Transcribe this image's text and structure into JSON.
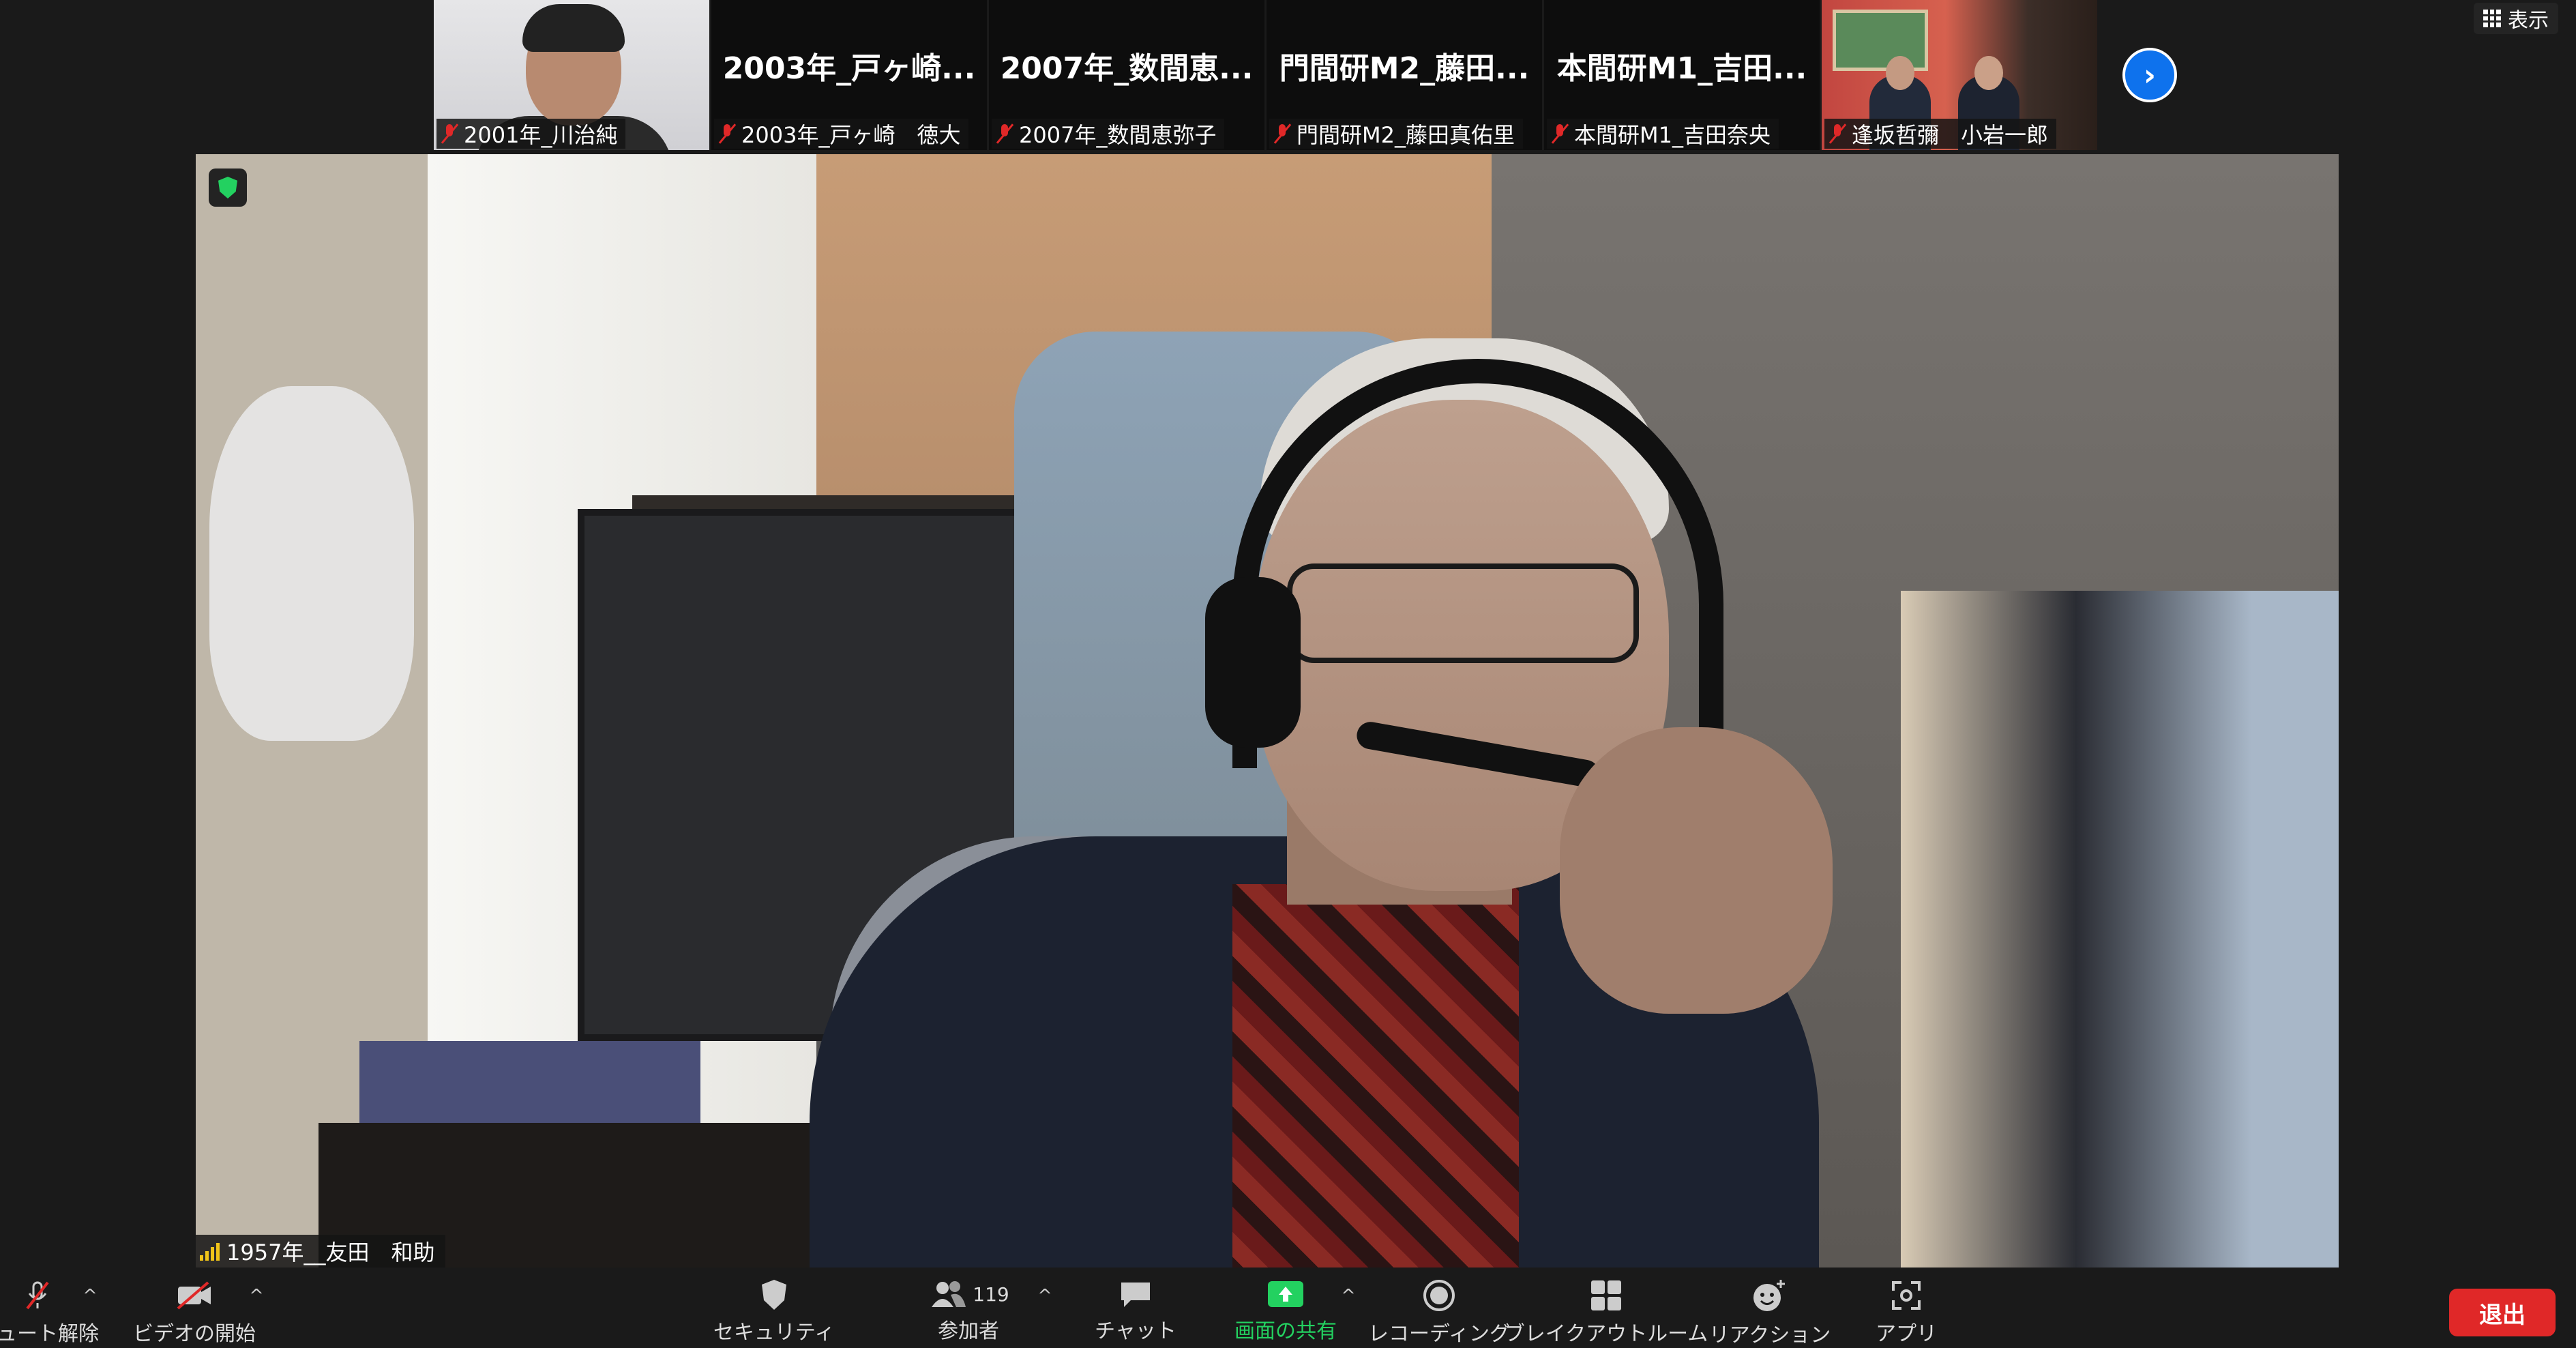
{
  "top": {
    "view_label": "表示",
    "thumbnails": [
      {
        "label": "2001年_川治純",
        "big": ""
      },
      {
        "label": "2003年_戸ヶ崎　徳大",
        "big": "2003年_戸ヶ崎..."
      },
      {
        "label": "2007年_数間恵弥子",
        "big": "2007年_数間恵..."
      },
      {
        "label": "門間研M2_藤田真佑里",
        "big": "門間研M2_藤田..."
      },
      {
        "label": "本間研M1_吉田奈央",
        "big": "本間研M1_吉田..."
      },
      {
        "label": "逢坂哲彌　小岩一郎",
        "big": ""
      }
    ],
    "next_icon": "chevron-right-icon"
  },
  "speaker": {
    "name": "1957年__友田　和助"
  },
  "toolbar": {
    "items": [
      {
        "label": "ミュート解除",
        "icon": "mic-muted-icon"
      },
      {
        "label": "ビデオの開始",
        "icon": "video-off-icon"
      },
      {
        "label": "セキュリティ",
        "icon": "shield-icon"
      },
      {
        "label": "参加者",
        "icon": "participants-icon",
        "count": "119"
      },
      {
        "label": "チャット",
        "icon": "chat-icon"
      },
      {
        "label": "画面の共有",
        "icon": "share-screen-icon"
      },
      {
        "label": "レコーディング",
        "icon": "record-icon"
      },
      {
        "label": "ブレイクアウトルーム",
        "icon": "breakout-rooms-icon"
      },
      {
        "label": "リアクション",
        "icon": "reaction-icon"
      },
      {
        "label": "アプリ",
        "icon": "apps-icon"
      }
    ],
    "leave_label": "退出"
  },
  "colors": {
    "accent_blue": "#0e72ed",
    "share_green": "#23d160",
    "leave_red": "#e02828",
    "muted_red": "#e02828",
    "signal_yellow": "#f0c419"
  }
}
